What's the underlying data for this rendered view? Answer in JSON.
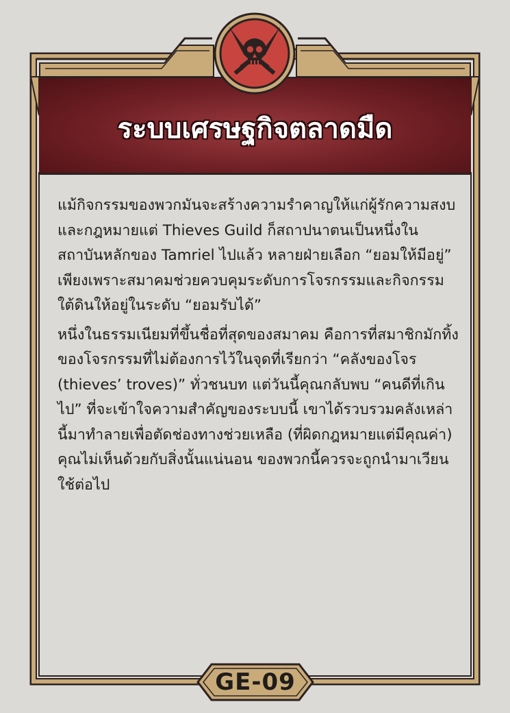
{
  "card": {
    "title": "ระบบเศรษฐกิจตลาดมืด",
    "emblem_icon": "skull-crossed-daggers-icon",
    "paragraphs": [
      "แม้กิจกรรมของพวกมันจะสร้างความรำคาญให้แก่ผู้รักความสงบและกฎหมายแต่ Thieves Guild ก็สถาปนาตนเป็นหนึ่งในสถาบันหลักของ Tamriel ไปแล้ว หลายฝ่ายเลือก “ยอมให้มีอยู่” เพียงเพราะสมาคมช่วยควบคุมระดับการโจรกรรมและกิจกรรมใต้ดินให้อยู่ในระดับ “ยอมรับได้”",
      "หนึ่งในธรรมเนียมที่ขึ้นชื่อที่สุดของสมาคม คือการที่สมาชิกมักทิ้งของโจรกรรมที่ไม่ต้องการไว้ในจุดที่เรียกว่า “คลังของโจร (thieves’ troves)” ทั่วชนบท แต่วันนี้คุณกลับพบ “คนดีที่เกินไป” ที่จะเข้าใจความสำคัญของระบบนี้ เขาได้รวบรวมคลังเหล่านี้มาทำลายเพื่อตัดช่องทางช่วยเหลือ (ที่ผิดกฎหมายแต่มีคุณค่า) คุณไม่เห็นด้วยกับสิ่งนั้นแน่นอน ของพวกนี้ควรจะถูกนำมาเวียนใช้ต่อไป"
    ],
    "code": "GE-09"
  },
  "colors": {
    "background": "#dbdad6",
    "frame_gold": "#c9ab7a",
    "frame_dark": "#2b2220",
    "header_red": "#6e1f24",
    "emblem_red": "#c8453f"
  }
}
